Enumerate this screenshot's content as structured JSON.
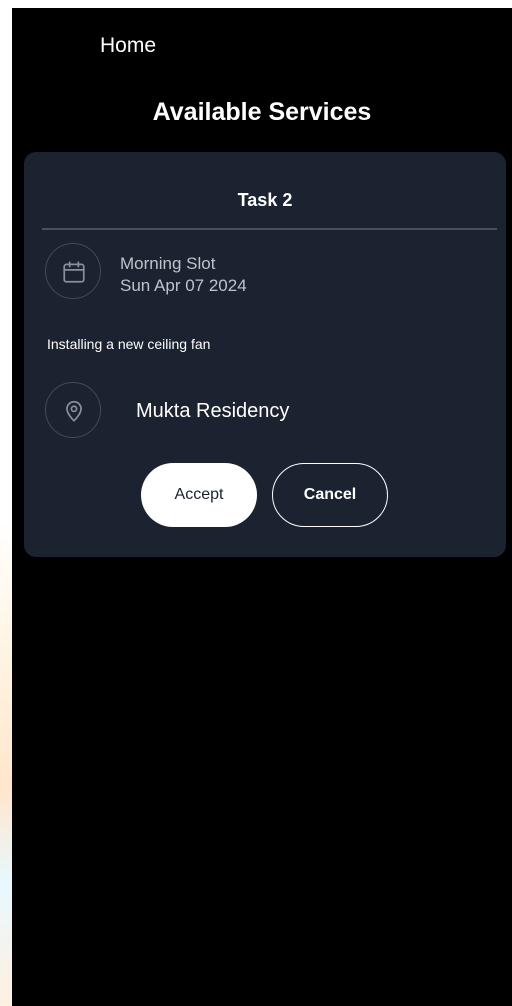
{
  "header": {
    "nav_title": "Home",
    "page_title": "Available Services"
  },
  "task_card": {
    "title": "Task 2",
    "slot": "Morning Slot",
    "date": "Sun Apr 07 2024",
    "description": "Installing a new ceiling fan",
    "location": "Mukta Residency",
    "icons": {
      "date": "calendar-icon",
      "location": "location-pin-icon"
    },
    "actions": {
      "accept_label": "Accept",
      "cancel_label": "Cancel"
    }
  },
  "colors": {
    "screen_background": "#000000",
    "card_background": "#1b2230",
    "primary_text": "#ffffff",
    "secondary_text": "#bfc3ca",
    "icon_stroke": "#8a9099"
  }
}
